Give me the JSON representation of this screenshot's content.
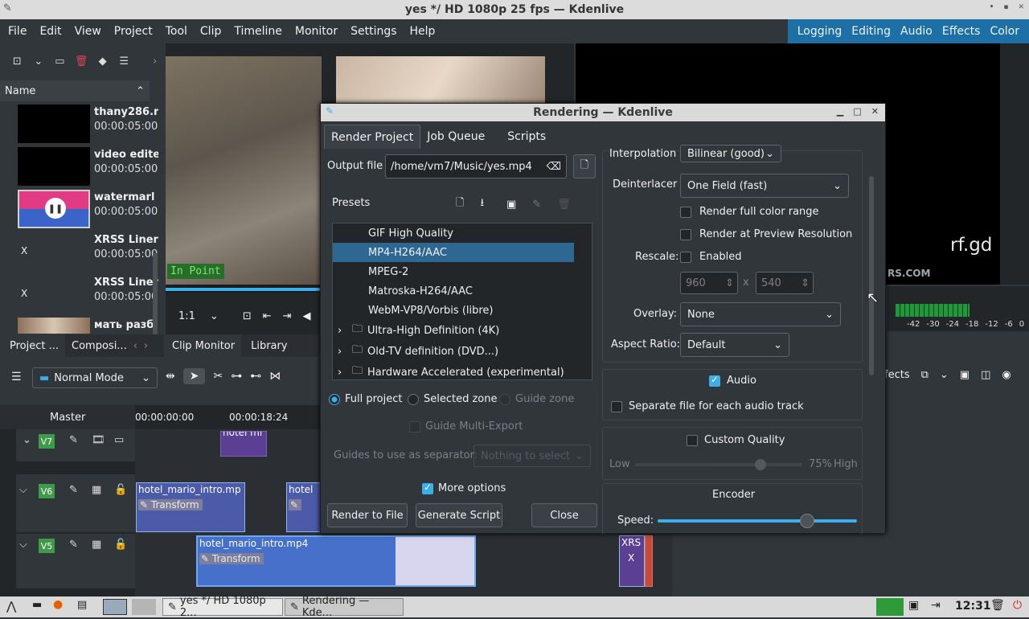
{
  "window_title": "yes */ HD 1080p 25 fps — Kdenlive",
  "menu": [
    "File",
    "Edit",
    "View",
    "Project",
    "Tool",
    "Clip",
    "Timeline",
    "Monitor",
    "Settings",
    "Help"
  ],
  "layouts": [
    "Logging",
    "Editing",
    "Audio",
    "Effects",
    "Color"
  ],
  "bin": {
    "header": "Name",
    "clips": [
      {
        "name": "thany286.r",
        "duration": "00:00:05:00"
      },
      {
        "name": "video edite",
        "duration": "00:00:05:00"
      },
      {
        "name": "watermarl",
        "duration": "00:00:05:00"
      },
      {
        "name": "XRSS Liner",
        "duration": "00:00:05:00",
        "mark": "X"
      },
      {
        "name": "XRSS Liner",
        "duration": "00:00:05:00",
        "mark": "X"
      },
      {
        "name": "мать разб",
        "duration": ""
      }
    ],
    "tabs": [
      "Project ...",
      "Composi..."
    ]
  },
  "clip_monitor": {
    "in_point": "In Point",
    "zoom": "1:1",
    "tabs": [
      "Clip Monitor",
      "Library"
    ]
  },
  "project_monitor": {
    "overlay_text": "rf.gd",
    "watermark": "RS.COM"
  },
  "vu_labels": [
    "-42",
    "-30",
    "-24",
    "-18",
    "-12",
    "-6",
    "0"
  ],
  "effects_label": "fects",
  "timeline": {
    "mode": "Normal Mode",
    "master": "Master",
    "ruler": [
      "00:00:00:00",
      "00:00:18:24"
    ],
    "tracks": [
      "V7",
      "V6",
      "V5"
    ],
    "clips": {
      "v7": "hotel mi",
      "v6a": "hotel_mario_intro.mp",
      "v6b": "hotel",
      "v5": "hotel_mario_intro.mp4",
      "v5x": "XRS",
      "v5x2": "X",
      "fx": "Transform"
    }
  },
  "dialog": {
    "title": "Rendering — Kdenlive",
    "tabs": [
      "Render Project",
      "Job Queue",
      "Scripts"
    ],
    "output_label": "Output file",
    "output_value": "/home/vm7/Music/yes.mp4",
    "presets_label": "Presets",
    "presets": [
      {
        "label": "GIF High Quality",
        "level": 1
      },
      {
        "label": "MP4-H264/AAC",
        "level": 1,
        "selected": true
      },
      {
        "label": "MPEG-2",
        "level": 1
      },
      {
        "label": "Matroska-H264/AAC",
        "level": 1
      },
      {
        "label": "WebM-VP8/Vorbis (libre)",
        "level": 1
      },
      {
        "label": "Ultra-High Definition (4K)",
        "level": 0
      },
      {
        "label": "Old-TV definition (DVD...)",
        "level": 0
      },
      {
        "label": "Hardware Accelerated (experimental)",
        "level": 0
      }
    ],
    "zone": {
      "full": "Full project",
      "selected": "Selected zone",
      "guide": "Guide zone"
    },
    "guide_multi": "Guide Multi-Export",
    "guides_sep_label": "Guides to use as separator:",
    "guides_sep_value": "Nothing to select",
    "more_options": "More options",
    "btn_render": "Render to File",
    "btn_script": "Generate Script",
    "btn_close": "Close",
    "interpolation_label": "Interpolation",
    "interpolation_value": "Bilinear (good)",
    "deinterlacer_label": "Deinterlacer",
    "deinterlacer_value": "One Field (fast)",
    "full_color": "Render full color range",
    "preview_res": "Render at Preview Resolution",
    "rescale_label": "Rescale:",
    "rescale_enabled": "Enabled",
    "rescale_w": "960",
    "rescale_x": "x",
    "rescale_h": "540",
    "overlay_label": "Overlay:",
    "overlay_value": "None",
    "aspect_label": "Aspect Ratio:",
    "aspect_value": "Default",
    "audio": "Audio",
    "sep_audio": "Separate file for each audio track",
    "custom_quality": "Custom Quality",
    "q_low": "Low",
    "q_pct": "75%",
    "q_high": "High",
    "quality_value": 0.75,
    "encoder": "Encoder",
    "speed_label": "Speed:",
    "speed_value": 0.75
  },
  "taskbar": {
    "task1": "yes */ HD 1080p 2...",
    "task2": "Rendering — Kde...",
    "clock": "12:31"
  }
}
